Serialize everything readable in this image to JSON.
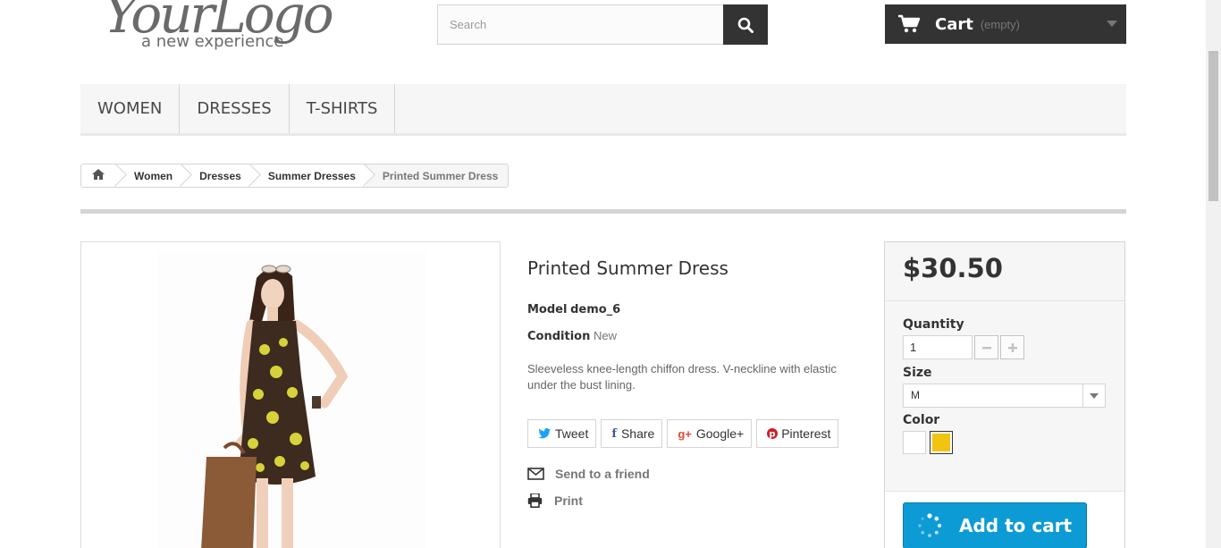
{
  "header": {
    "logo_main": "YourLogo",
    "logo_tagline": "a new experience",
    "search": {
      "placeholder": "Search"
    },
    "cart": {
      "title": "Cart",
      "status": "(empty)"
    }
  },
  "menu": {
    "items": [
      {
        "label": "WOMEN"
      },
      {
        "label": "DRESSES"
      },
      {
        "label": "T-SHIRTS"
      }
    ]
  },
  "breadcrumb": {
    "items": [
      {
        "label": "Women"
      },
      {
        "label": "Dresses"
      },
      {
        "label": "Summer Dresses"
      },
      {
        "label": "Printed Summer Dress"
      }
    ]
  },
  "product": {
    "name": "Printed Summer Dress",
    "model_label": "Model",
    "model": "demo_6",
    "condition_label": "Condition",
    "condition": "New",
    "description": "Sleeveless knee-length chiffon dress. V-neckline with elastic under the bust lining.",
    "social": [
      {
        "icon": "twitter-icon",
        "label": "Tweet"
      },
      {
        "icon": "facebook-icon",
        "label": "Share"
      },
      {
        "icon": "google-plus-icon",
        "label": "Google+"
      },
      {
        "icon": "pinterest-icon",
        "label": "Pinterest"
      }
    ],
    "send_to_friend": "Send to a friend",
    "print": "Print"
  },
  "buy": {
    "price": "$30.50",
    "quantity_label": "Quantity",
    "quantity": "1",
    "size_label": "Size",
    "size": "M",
    "color_label": "Color",
    "colors": [
      "#ffffff",
      "#f1c40f"
    ],
    "add_to_cart": "Add to cart"
  },
  "colors": {
    "accent": "#0d9bd5",
    "dark": "#333333"
  }
}
